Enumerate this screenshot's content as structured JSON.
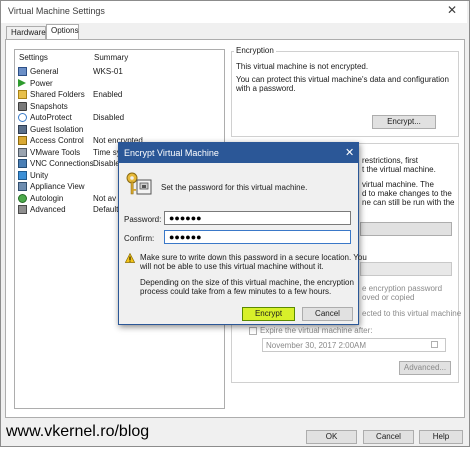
{
  "window": {
    "title": "Virtual Machine Settings",
    "close_glyph": "✕",
    "tabs": [
      {
        "label": "Hardware"
      },
      {
        "label": "Options"
      }
    ]
  },
  "settings": {
    "header_settings": "Settings",
    "header_summary": "Summary",
    "items": [
      {
        "label": "General",
        "summary": "WKS-01",
        "icon": "general-icon"
      },
      {
        "label": "Power",
        "summary": "",
        "icon": "power-icon"
      },
      {
        "label": "Shared Folders",
        "summary": "Enabled",
        "icon": "shared-folders-icon"
      },
      {
        "label": "Snapshots",
        "summary": "",
        "icon": "snapshots-icon"
      },
      {
        "label": "AutoProtect",
        "summary": "Disabled",
        "icon": "autoprotect-icon"
      },
      {
        "label": "Guest Isolation",
        "summary": "",
        "icon": "guest-isolation-icon"
      },
      {
        "label": "Access Control",
        "summary": "Not encrypted",
        "icon": "access-control-icon"
      },
      {
        "label": "VMware Tools",
        "summary": "Time sy",
        "icon": "vmware-tools-icon"
      },
      {
        "label": "VNC Connections",
        "summary": "Disable",
        "icon": "vnc-icon"
      },
      {
        "label": "Unity",
        "summary": "",
        "icon": "unity-icon"
      },
      {
        "label": "Appliance View",
        "summary": "",
        "icon": "appliance-view-icon"
      },
      {
        "label": "Autologin",
        "summary": "Not av",
        "icon": "autologin-icon"
      },
      {
        "label": "Advanced",
        "summary": "Default",
        "icon": "advanced-icon"
      }
    ]
  },
  "encryption": {
    "group_title": "Encryption",
    "status": "This virtual machine is not encrypted.",
    "desc_line1": "You can protect this virtual machine's data and configuration",
    "desc_line2": "with a password.",
    "encrypt_button": "Encrypt..."
  },
  "behind": {
    "r1": "restrictions, first",
    "r2": "t the virtual machine.",
    "r3": "virtual machine. The",
    "r4": "d to make changes to the",
    "r5": "ne can still be run with the",
    "p1": "e encryption password",
    "p2": "oved or copied",
    "p3": "ected to this virtual machine",
    "expire_label": "Expire the virtual machine after:",
    "date_value": "November 30, 2017   2:00AM",
    "advanced_button": "Advanced..."
  },
  "dialog": {
    "title": "Encrypt Virtual Machine",
    "close_glyph": "✕",
    "prompt": "Set the password for this virtual machine.",
    "password_label": "Password:",
    "password_value": "●●●●●●",
    "confirm_label": "Confirm:",
    "confirm_value": "●●●●●●",
    "warning_line1": "Make sure to write down this password in a secure location. You",
    "warning_line2": "will not be able to use this virtual machine without it.",
    "info_line1": "Depending on the size of this virtual machine, the encryption",
    "info_line2": "process could take from a few minutes to a few hours.",
    "encrypt_button": "Encrypt",
    "cancel_button": "Cancel"
  },
  "footer": {
    "watermark": "www.vkernel.ro/blog",
    "ok_button": "OK",
    "cancel_button": "Cancel",
    "help_button": "Help"
  },
  "colors": {
    "dialog_title": "#2b5797",
    "encrypt_highlight": "#d8f02a"
  }
}
